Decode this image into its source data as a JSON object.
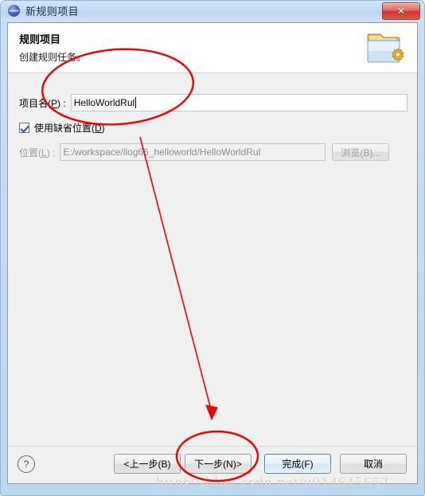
{
  "window": {
    "title": "新规则项目",
    "icon": "sphere-icon",
    "close_label": "✕"
  },
  "banner": {
    "title": "规则项目",
    "subtitle": "创建规则任务。",
    "icon": "folder-gear-icon"
  },
  "form": {
    "project_name": {
      "label": "项目名(",
      "mnemonic": "P",
      "label_suffix": ") :",
      "value": "HelloWorldRul",
      "placeholder": ""
    },
    "use_default_location": {
      "label": "使用缺省位置(",
      "mnemonic": "D",
      "label_suffix": ")",
      "checked": true
    },
    "location": {
      "label": "位置(",
      "mnemonic": "L",
      "label_suffix": ") :",
      "value": "E:/workspace/ilog66_helloworld/HelloWorldRul",
      "enabled": false
    },
    "browse_button": "浏览(B)..."
  },
  "buttons": {
    "help": "?",
    "back": "<上一步(B)",
    "next": "下一步(N)>",
    "finish": "完成(F)",
    "cancel": "取消"
  },
  "annotations": {
    "ellipse_top": "highlight-project-name-field",
    "ellipse_bottom": "highlight-next-button",
    "arrow": "arrow-from-name-field-to-next-button",
    "color": "#ee0000"
  },
  "watermark": "https://blog.csdn.net/u014645652",
  "colors": {
    "accent": "#3c8cd4",
    "annotation": "#ee0000",
    "dialog_bg": "#f0f0f0",
    "banner_bg": "#ffffff",
    "titlebar_bg": "#c5dcf2",
    "close_button": "#c93a2c"
  }
}
